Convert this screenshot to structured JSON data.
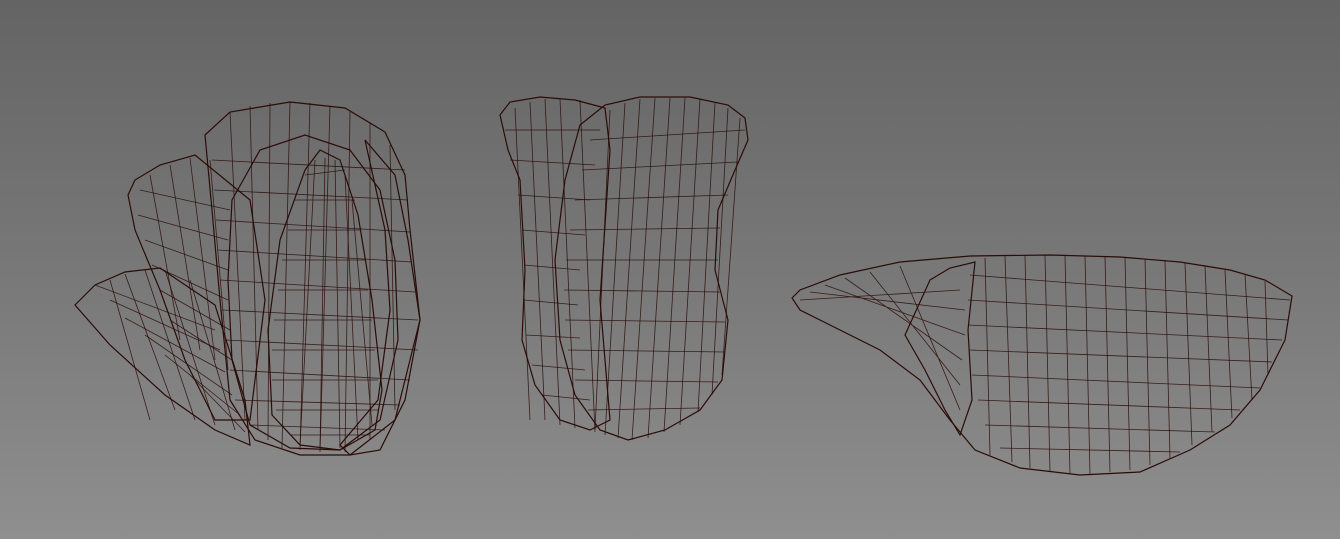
{
  "viewport": {
    "background_top": "#646464",
    "background_bottom": "#8f8f8f",
    "mesh_color": "#c0503f",
    "wire_color": "#2a0c08"
  },
  "models": [
    {
      "name": "petal-cluster-open",
      "view": "three-quarter"
    },
    {
      "name": "petal-cluster-closed",
      "view": "front"
    },
    {
      "name": "single-petal",
      "view": "side"
    }
  ]
}
